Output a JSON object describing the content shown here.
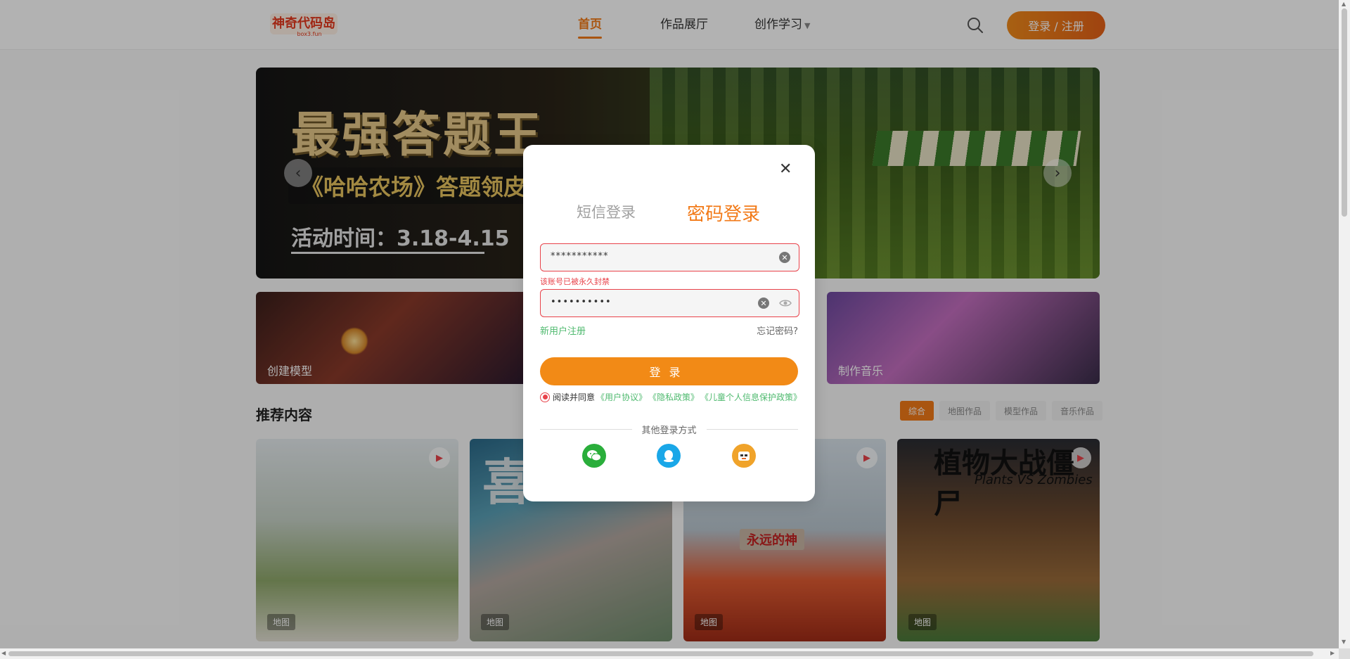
{
  "header": {
    "logo_text": "神奇代码岛",
    "logo_sub": "box3.fun",
    "nav": [
      {
        "label": "首页",
        "active": true
      },
      {
        "label": "作品展厅",
        "active": false
      },
      {
        "label": "创作学习",
        "active": false
      }
    ],
    "login_label": "登录 / 注册"
  },
  "banner": {
    "title": "最强答题王",
    "subtitle": "《哈哈农场》答题领皮",
    "date": "活动时间：3.18-4.15"
  },
  "cards": [
    {
      "label": "创建模型"
    },
    {
      "label": "制作音乐"
    }
  ],
  "recommend": {
    "title": "推荐内容",
    "filters": [
      "综合",
      "地图作品",
      "模型作品",
      "音乐作品"
    ],
    "tiles": [
      {
        "tag": "地图"
      },
      {
        "tag": "地图",
        "art_text": "喜"
      },
      {
        "tag": "地图",
        "art_text": "永远的神"
      },
      {
        "tag": "地图",
        "art_text": "植物大战僵尸",
        "art_en": "Plants VS Zombies"
      }
    ]
  },
  "modal": {
    "tabs": [
      "短信登录",
      "密码登录"
    ],
    "active_tab": "密码登录",
    "account_value": "***********",
    "error": "该账号已被永久封禁",
    "password_value": "••••••••••",
    "register_link": "新用户注册",
    "forgot_link": "忘记密码?",
    "submit_label": "登录",
    "agree_text": "阅读并同意",
    "agree_links": [
      "《用户协议》",
      "《隐私政策》",
      "《儿童个人信息保护政策》"
    ],
    "other_login": "其他登录方式"
  },
  "colors": {
    "accent": "#f27a18",
    "error": "#e8424a",
    "link": "#4fba6f"
  }
}
